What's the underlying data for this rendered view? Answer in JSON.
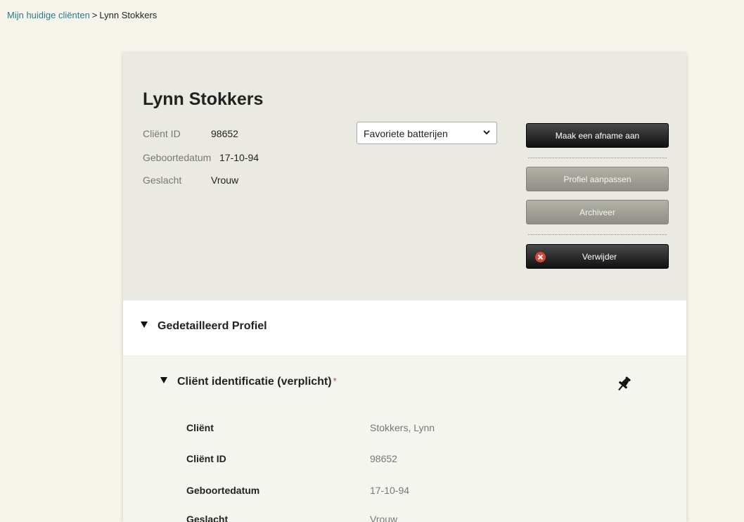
{
  "breadcrumb": {
    "link": "Mijn huidige cliënten",
    "separator": ">",
    "current": "Lynn Stokkers"
  },
  "client": {
    "name": "Lynn Stokkers",
    "info": [
      {
        "label": "Cliënt ID",
        "value": "98652"
      },
      {
        "label": "Geboortedatum",
        "value": "17-10-94"
      },
      {
        "label": "Geslacht",
        "value": "Vrouw"
      }
    ]
  },
  "battery_select": {
    "selected": "Favoriete batterijen",
    "icon": "chevron-down-icon"
  },
  "actions": {
    "create_assessment": "Maak een afname aan",
    "edit_profile": "Profiel aanpassen",
    "archive": "Archiveer",
    "delete": "Verwijder",
    "delete_icon": "close-circle-icon"
  },
  "detailed_profile": {
    "title": "Gedetailleerd Profiel",
    "icon": "triangle-down-icon"
  },
  "identification": {
    "title": "Cliënt identificatie (verplicht)",
    "required_marker": "*",
    "pin_icon": "pin-icon",
    "fields": [
      {
        "label": "Cliënt",
        "value": "Stokkers, Lynn"
      },
      {
        "label": "Cliënt ID",
        "value": "98652"
      },
      {
        "label": "Geboortedatum",
        "value": "17-10-94"
      },
      {
        "label": "Geslacht",
        "value": "Vrouw"
      }
    ]
  },
  "colors": {
    "page_bg": "#f6f5ec",
    "header_bg": "#ebeae2",
    "link": "#2a7a8c",
    "dark_button": "#1a1a1a",
    "grey_button": "#a3a29a",
    "delete_icon": "#d9463a",
    "required": "#c33333"
  }
}
